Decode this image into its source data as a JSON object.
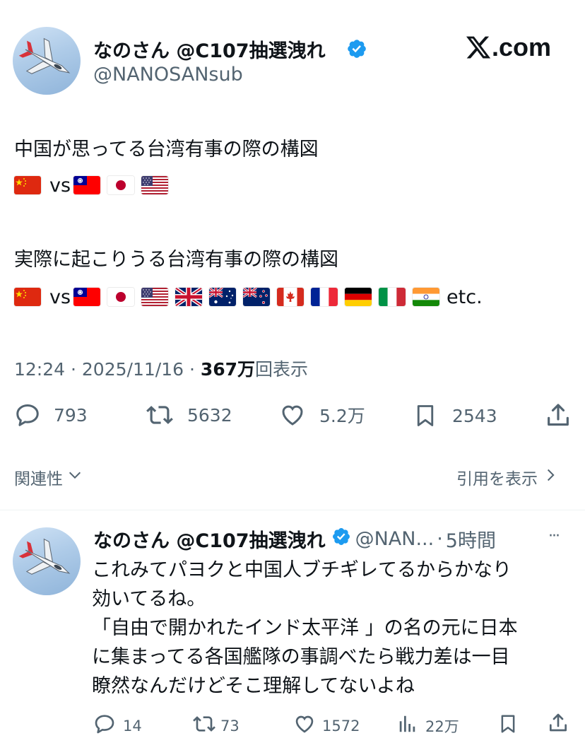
{
  "post": {
    "author_name": "なのさん @C107抽選洩れ",
    "author_handle": "@NANOSANsub",
    "site_brand": ".com",
    "line1": "中国が思ってる台湾有事の際の構図",
    "vs": "vs",
    "line2": "実際に起こりうる台湾有事の際の構図",
    "etc": "etc.",
    "flags_row1_left": [
      "china-flag"
    ],
    "flags_row1_right": [
      "taiwan-flag",
      "japan-flag",
      "usa-flag"
    ],
    "flags_row2_left": [
      "china-flag"
    ],
    "flags_row2_right": [
      "taiwan-flag",
      "japan-flag",
      "usa-flag",
      "uk-flag",
      "australia-flag",
      "new-zealand-flag",
      "canada-flag",
      "france-flag",
      "germany-flag",
      "italy-flag",
      "india-flag"
    ],
    "time": "12:24",
    "sep1": "·",
    "date": "2025/11/16",
    "sep2": "·",
    "views_count": "367万",
    "views_label": "回表示",
    "replies": "793",
    "reposts": "5632",
    "likes": "5.2万",
    "bookmarks": "2543",
    "related_label": "関連性",
    "show_quotes_label": "引用を表示"
  },
  "reply": {
    "author_name": "なのさん @C107抽選洩れ",
    "author_handle": "@NAN...",
    "time_sep": "·",
    "time_ago": "5時間",
    "more": "···",
    "lines": [
      "これみてパヨクと中国人ブチギレてるからかなり",
      "効いてるね。",
      "「自由で開かれたインド太平洋 」の名の元に日本",
      "に集まってる各国艦隊の事調べたら戦力差は一目",
      "瞭然なんだけどそこ理解してないよね"
    ],
    "replies": "14",
    "reposts": "73",
    "likes": "1572",
    "views": "22万"
  },
  "colors": {
    "text": "#0f1419",
    "muted": "#536471",
    "verified": "#1d9bf0",
    "divider": "#eff3f4"
  }
}
